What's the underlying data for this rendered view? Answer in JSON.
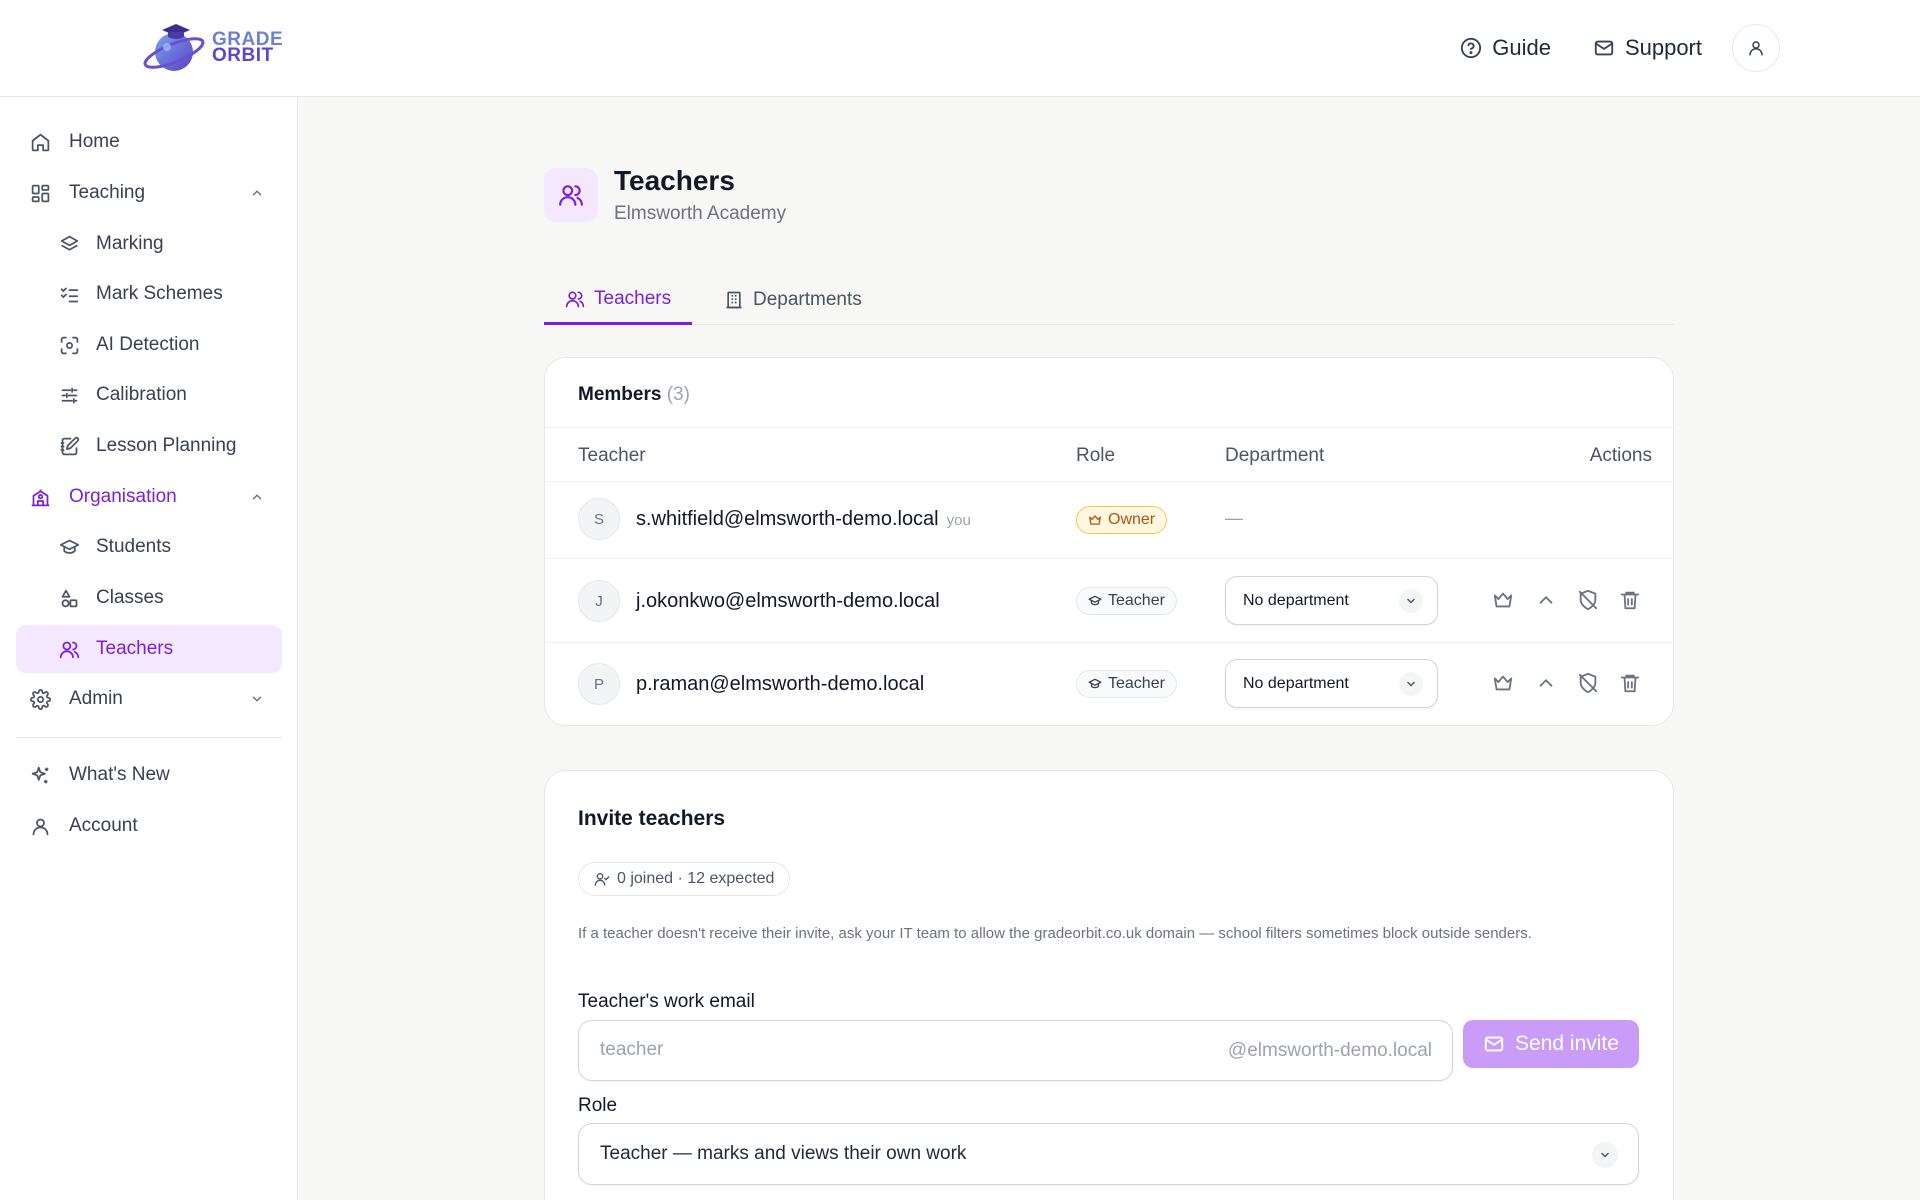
{
  "app": {
    "logo_line1": "GRADE",
    "logo_line2": "ORBIT",
    "accent": "#7c1fd6"
  },
  "header": {
    "guide_label": "Guide",
    "support_label": "Support"
  },
  "sidebar": {
    "items": [
      {
        "label": "Home",
        "icon": "home-icon"
      },
      {
        "label": "Teaching",
        "icon": "dashboard-icon",
        "expanded": true
      },
      {
        "label": "Marking",
        "icon": "layers-icon"
      },
      {
        "label": "Mark Schemes",
        "icon": "checklist-icon"
      },
      {
        "label": "AI Detection",
        "icon": "scan-icon"
      },
      {
        "label": "Calibration",
        "icon": "sliders-icon"
      },
      {
        "label": "Lesson Planning",
        "icon": "notebook-pen-icon"
      },
      {
        "label": "Organisation",
        "icon": "school-icon",
        "expanded": true
      },
      {
        "label": "Students",
        "icon": "graduation-cap-icon"
      },
      {
        "label": "Classes",
        "icon": "shapes-icon"
      },
      {
        "label": "Teachers",
        "icon": "users-icon",
        "active": true
      },
      {
        "label": "Admin",
        "icon": "gear-icon",
        "expanded": false
      },
      {
        "label": "What's New",
        "icon": "sparkles-icon"
      },
      {
        "label": "Account",
        "icon": "user-icon"
      }
    ]
  },
  "page": {
    "title": "Teachers",
    "subtitle": "Elmsworth Academy"
  },
  "tabs": [
    {
      "label": "Teachers",
      "active": true
    },
    {
      "label": "Departments",
      "active": false
    }
  ],
  "members": {
    "title": "Members",
    "count": "(3)",
    "columns": [
      "Teacher",
      "Role",
      "Department",
      "Actions"
    ],
    "rows": [
      {
        "initial": "S",
        "email": "s.whitfield@elmsworth-demo.local",
        "you": "you",
        "role": "Owner",
        "department": "—"
      },
      {
        "initial": "J",
        "email": "j.okonkwo@elmsworth-demo.local",
        "role": "Teacher",
        "department": "No department"
      },
      {
        "initial": "P",
        "email": "p.raman@elmsworth-demo.local",
        "role": "Teacher",
        "department": "No department"
      }
    ]
  },
  "invite": {
    "title": "Invite teachers",
    "status": "0 joined · 12 expected",
    "help": "If a teacher doesn't receive their invite, ask your IT team to allow the gradeorbit.co.uk domain — school filters sometimes block outside senders.",
    "email_label": "Teacher's work email",
    "email_placeholder": "teacher",
    "email_suffix": "@elmsworth-demo.local",
    "send_label": "Send invite",
    "role_label": "Role",
    "role_value": "Teacher — marks and views their own work"
  }
}
